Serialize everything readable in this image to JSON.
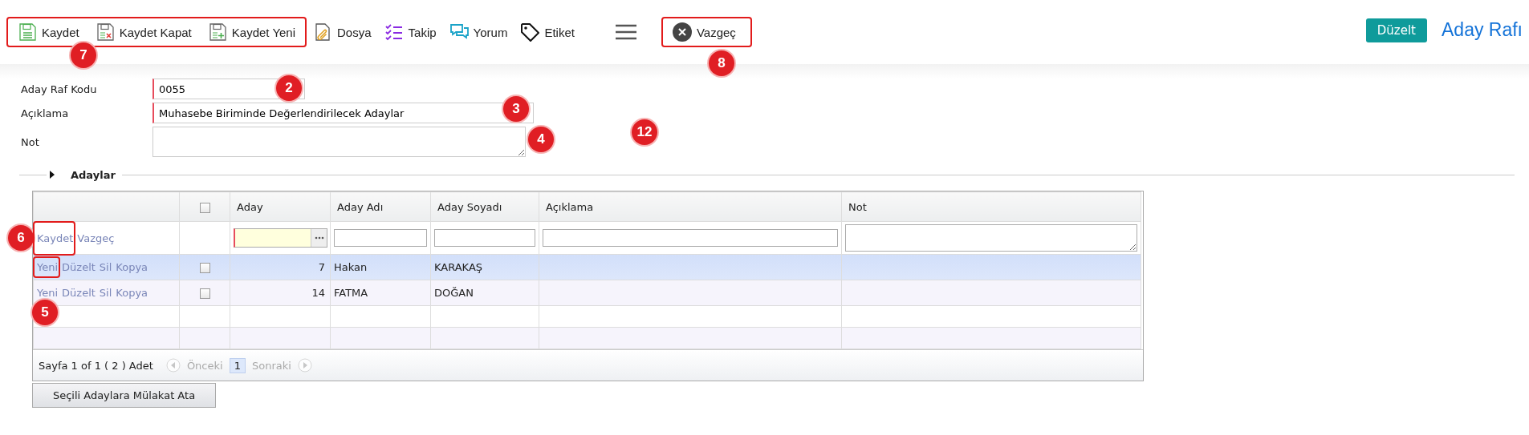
{
  "toolbar": {
    "save_group": [
      {
        "label": "Kaydet"
      },
      {
        "label": "Kaydet Kapat"
      },
      {
        "label": "Kaydet Yeni"
      }
    ],
    "items": [
      {
        "label": "Dosya"
      },
      {
        "label": "Takip"
      },
      {
        "label": "Yorum"
      },
      {
        "label": "Etiket"
      }
    ],
    "cancel_button": {
      "label": "Vazgeç"
    },
    "edit_button": {
      "label": "Düzelt"
    },
    "page_title": "Aday Rafı"
  },
  "form": {
    "fields": [
      {
        "label": "Aday Raf Kodu",
        "value": "0055",
        "required": true,
        "kind": "short"
      },
      {
        "label": "Açıklama",
        "value": "Muhasebe Biriminde Değerlendirilecek Adaylar",
        "required": true,
        "kind": "long"
      },
      {
        "label": "Not",
        "required": false,
        "kind": "textarea"
      }
    ]
  },
  "section": {
    "title": "Adaylar"
  },
  "grid": {
    "header_checkbox": {
      "checked": false
    },
    "columns": [
      "Aday",
      "Aday Adı",
      "Aday Soyadı",
      "Açıklama",
      "Not"
    ],
    "edit_row": {
      "actions": [
        "Kaydet",
        "Vazgeç"
      ]
    },
    "rows": [
      {
        "actions": [
          "Yeni",
          "Düzelt",
          "Sil",
          "Kopya"
        ],
        "checked": false,
        "selected": true,
        "aday": "7",
        "ad": "Hakan",
        "soyad": "KARAKAŞ"
      },
      {
        "actions": [
          "Yeni",
          "Düzelt",
          "Sil",
          "Kopya"
        ],
        "checked": false,
        "selected": false,
        "aday": "14",
        "ad": "FATMA",
        "soyad": "DOĞAN"
      }
    ],
    "pager": {
      "summary": "Sayfa 1 of 1 ( 2 ) Adet",
      "previous": {
        "label": "Önceki",
        "disabled": true
      },
      "pages": [
        {
          "label": "1",
          "selected": true
        }
      ],
      "next": {
        "label": "Sonraki",
        "disabled": true
      }
    }
  },
  "action_button": {
    "label": "Seçili Adaylara Mülakat Ata"
  },
  "annotations": [
    {
      "label": "7"
    },
    {
      "label": "8"
    },
    {
      "label": "2"
    },
    {
      "label": "3"
    },
    {
      "label": "4"
    },
    {
      "label": "12"
    },
    {
      "label": "6"
    },
    {
      "label": "5"
    }
  ]
}
